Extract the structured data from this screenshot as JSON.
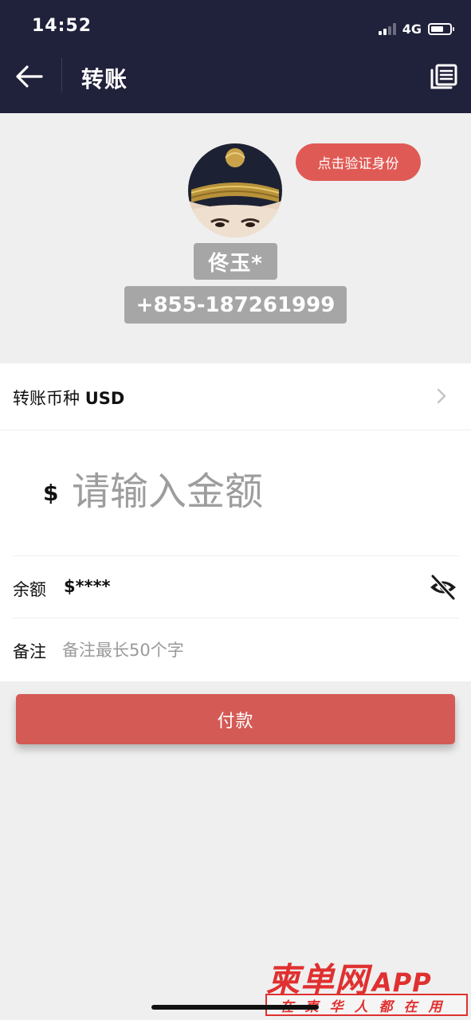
{
  "status_bar": {
    "time": "14:52",
    "network": "4G",
    "signal_bars": 2,
    "battery_level": 0.7
  },
  "nav": {
    "title": "转账",
    "back_icon": "arrow-left-icon",
    "records_icon": "list-document-icon"
  },
  "profile": {
    "verify_button": "点击验证身份",
    "name": "佟玉*",
    "phone": "+855-187261999"
  },
  "form": {
    "currency_label": "转账币种",
    "currency_value": "USD",
    "currency_sign": "$",
    "amount_placeholder": "请输入金额",
    "balance_label": "余额",
    "balance_value": "$****",
    "note_label": "备注",
    "note_placeholder": "备注最长50个字"
  },
  "pay_button": "付款",
  "watermark": {
    "title": "柬单网",
    "app": "APP",
    "slogan": "在柬华人都在用"
  },
  "colors": {
    "header_bg": "#20213a",
    "accent_red": "#e05a55",
    "pay_red": "#d45a55",
    "chip_gray": "#a6a6a6",
    "page_bg": "#efefef"
  }
}
